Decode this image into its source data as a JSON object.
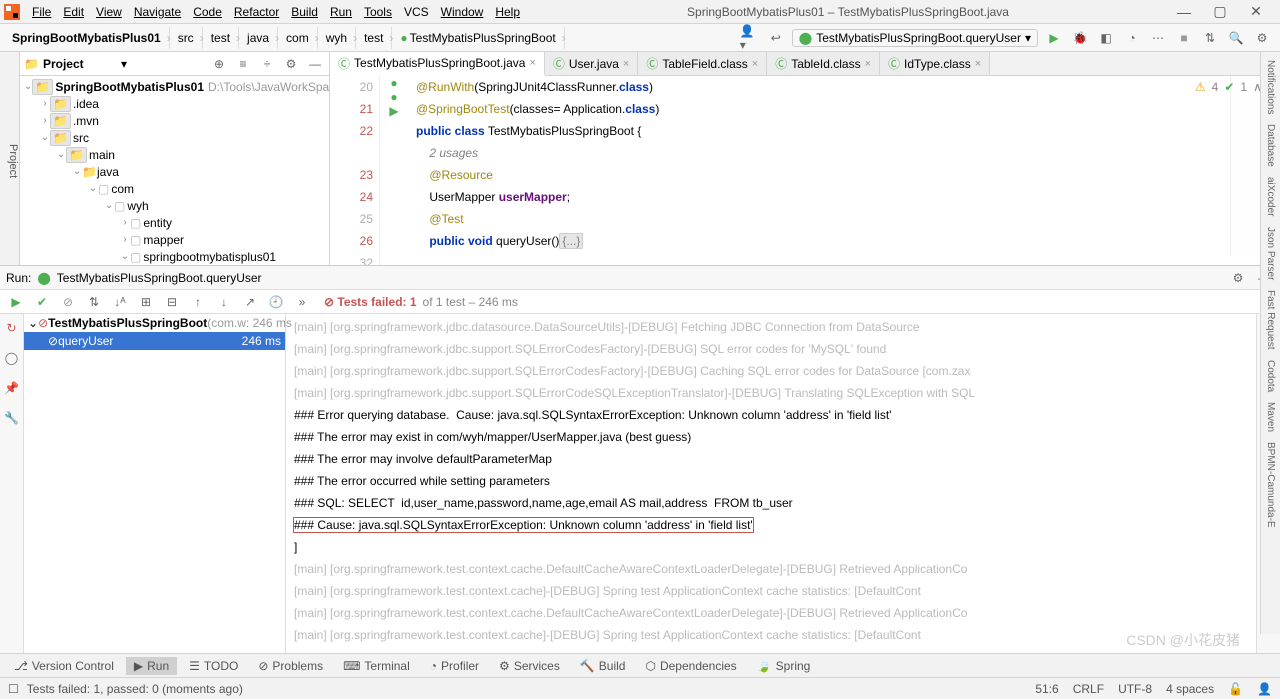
{
  "window": {
    "title": "SpringBootMybatisPlus01 – TestMybatisPlusSpringBoot.java"
  },
  "menu": [
    "File",
    "Edit",
    "View",
    "Navigate",
    "Code",
    "Refactor",
    "Build",
    "Run",
    "Tools",
    "VCS",
    "Window",
    "Help"
  ],
  "breadcrumbs": [
    "SpringBootMybatisPlus01",
    "src",
    "test",
    "java",
    "com",
    "wyh",
    "test",
    "TestMybatisPlusSpringBoot"
  ],
  "runConfig": "TestMybatisPlusSpringBoot.queryUser",
  "project": {
    "label": "Project",
    "root": "SpringBootMybatisPlus01",
    "rootPath": "D:\\Tools\\JavaWorkSpace\\Sprin",
    "nodes": [
      {
        "depth": 1,
        "name": ".idea",
        "icon": "folder",
        "arrow": "›"
      },
      {
        "depth": 1,
        "name": ".mvn",
        "icon": "folder",
        "arrow": "›"
      },
      {
        "depth": 1,
        "name": "src",
        "icon": "folder",
        "arrow": "⌄"
      },
      {
        "depth": 2,
        "name": "main",
        "icon": "folder",
        "arrow": "⌄"
      },
      {
        "depth": 3,
        "name": "java",
        "icon": "folder-blue",
        "arrow": "⌄"
      },
      {
        "depth": 4,
        "name": "com",
        "icon": "pkg",
        "arrow": "⌄"
      },
      {
        "depth": 5,
        "name": "wyh",
        "icon": "pkg",
        "arrow": "⌄"
      },
      {
        "depth": 6,
        "name": "entity",
        "icon": "pkg",
        "arrow": "›"
      },
      {
        "depth": 6,
        "name": "mapper",
        "icon": "pkg",
        "arrow": "›"
      },
      {
        "depth": 6,
        "name": "springbootmybatisplus01",
        "icon": "pkg",
        "arrow": "⌄"
      }
    ]
  },
  "editorTabs": [
    {
      "name": "TestMybatisPlusSpringBoot.java",
      "active": true,
      "icon": "class"
    },
    {
      "name": "User.java",
      "active": false,
      "icon": "class"
    },
    {
      "name": "TableField.class",
      "active": false,
      "icon": "class-dim"
    },
    {
      "name": "TableId.class",
      "active": false,
      "icon": "class-dim"
    },
    {
      "name": "IdType.class",
      "active": false,
      "icon": "class-dim"
    }
  ],
  "inspections": {
    "warn": "4",
    "ok": "1"
  },
  "lineNumbers": [
    "20",
    "21",
    "22",
    "23",
    "24",
    "25",
    "26",
    "32"
  ],
  "redLines": [
    "21",
    "22",
    "23",
    "24",
    "26"
  ],
  "code": [
    "@RunWith(SpringJUnit4ClassRunner.class)",
    "@SpringBootTest(classes= Application.class)",
    "public class TestMybatisPlusSpringBoot {",
    "    2 usages",
    "    @Resource",
    "    UserMapper userMapper;",
    "    @Test",
    "    public void queryUser(){...}",
    ""
  ],
  "run": {
    "label": "Run:",
    "config": "TestMybatisPlusSpringBoot.queryUser",
    "testsFailed": "Tests failed: 1",
    "testsSummary": "of 1 test – 246 ms",
    "tree": {
      "root": "TestMybatisPlusSpringBoot",
      "rootMeta": "(com.w: 246 ms",
      "leaf": "queryUser",
      "leafTime": "246 ms"
    }
  },
  "console": [
    {
      "style": "faded",
      "text": "[main] [org.springframework.jdbc.datasource.DataSourceUtils]-[DEBUG] Fetching JDBC Connection from DataSource"
    },
    {
      "style": "faded",
      "text": "[main] [org.springframework.jdbc.support.SQLErrorCodesFactory]-[DEBUG] SQL error codes for 'MySQL' found"
    },
    {
      "style": "faded",
      "text": "[main] [org.springframework.jdbc.support.SQLErrorCodesFactory]-[DEBUG] Caching SQL error codes for DataSource [com.zax"
    },
    {
      "style": "faded",
      "text": "[main] [org.springframework.jdbc.support.SQLErrorCodeSQLExceptionTranslator]-[DEBUG] Translating SQLException with SQL"
    },
    {
      "style": "",
      "text": "### Error querying database.  Cause: java.sql.SQLSyntaxErrorException: Unknown column 'address' in 'field list'"
    },
    {
      "style": "",
      "text": "### The error may exist in com/wyh/mapper/UserMapper.java (best guess)"
    },
    {
      "style": "",
      "text": "### The error may involve defaultParameterMap"
    },
    {
      "style": "",
      "text": "### The error occurred while setting parameters"
    },
    {
      "style": "",
      "text": "### SQL: SELECT  id,user_name,password,name,age,email AS mail,address  FROM tb_user"
    },
    {
      "style": "hl",
      "text": "### Cause: java.sql.SQLSyntaxErrorException: Unknown column 'address' in 'field list'"
    },
    {
      "style": "",
      "text": "]"
    },
    {
      "style": "faded",
      "text": "[main] [org.springframework.test.context.cache.DefaultCacheAwareContextLoaderDelegate]-[DEBUG] Retrieved ApplicationCo"
    },
    {
      "style": "faded",
      "text": "[main] [org.springframework.test.context.cache]-[DEBUG] Spring test ApplicationContext cache statistics: [DefaultCont"
    },
    {
      "style": "faded",
      "text": "[main] [org.springframework.test.context.cache.DefaultCacheAwareContextLoaderDelegate]-[DEBUG] Retrieved ApplicationCo"
    },
    {
      "style": "faded",
      "text": "[main] [org.springframework.test.context.cache]-[DEBUG] Spring test ApplicationContext cache statistics: [DefaultCont"
    }
  ],
  "bottomTabs": [
    "Version Control",
    "Run",
    "TODO",
    "Problems",
    "Terminal",
    "Profiler",
    "Services",
    "Build",
    "Dependencies",
    "Spring"
  ],
  "status": {
    "left": "Tests failed: 1, passed: 0 (moments ago)",
    "pos": "51:6",
    "sep": "CRLF",
    "enc": "UTF-8",
    "indent": "4 spaces"
  },
  "rightTabs": [
    "Notifications",
    "Database",
    "aiXcoder",
    "Json Parser",
    "Fast Request",
    "Codota",
    "Maven",
    "BPMN-Camunda-E"
  ],
  "watermark": "CSDN @小花皮猪"
}
